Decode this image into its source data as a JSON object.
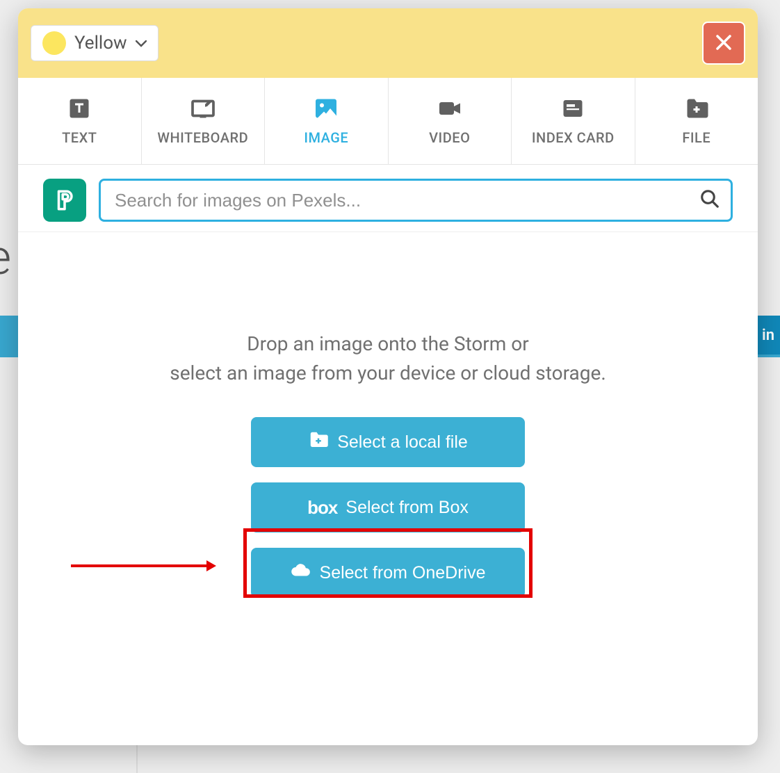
{
  "header": {
    "color_label": "Yellow",
    "swatch_color": "#fce65f"
  },
  "tabs": [
    {
      "label": "TEXT",
      "icon": "text-icon",
      "active": false
    },
    {
      "label": "WHITEBOARD",
      "icon": "whiteboard-icon",
      "active": false
    },
    {
      "label": "IMAGE",
      "icon": "image-icon",
      "active": true
    },
    {
      "label": "VIDEO",
      "icon": "video-icon",
      "active": false
    },
    {
      "label": "INDEX CARD",
      "icon": "index-card-icon",
      "active": false
    },
    {
      "label": "FILE",
      "icon": "file-icon",
      "active": false
    }
  ],
  "search": {
    "placeholder": "Search for images on Pexels..."
  },
  "instruction": {
    "line1": "Drop an image onto the Storm or",
    "line2": "select an image from your device or cloud storage."
  },
  "buttons": {
    "local": "Select a local file",
    "box": "Select from Box",
    "onedrive": "Select from OneDrive"
  },
  "annotation": {
    "highlight_target": "select-from-box-button",
    "arrow_color": "#e30000"
  },
  "backdrop": {
    "partial_text": "e",
    "side_label": "in"
  }
}
